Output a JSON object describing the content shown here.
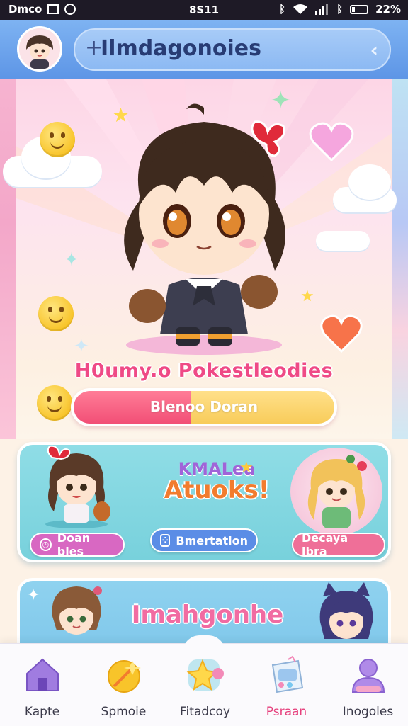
{
  "status_bar": {
    "left_text": "Dmco",
    "time": "8S11",
    "battery": "22%",
    "battery_level": 0.22
  },
  "header": {
    "search_text": "Ilmdagonoies",
    "search_icon": "plus-cursor-icon",
    "back_icon": "chevron-left-icon",
    "avatar_icon": "chibi-avatar"
  },
  "hero": {
    "title": "H0umy.o Pokestleodies",
    "progress_label": "Blenoo Doran",
    "progress_fraction": 0.45,
    "colors": {
      "fill": "#f24f76",
      "rest": "#f8cc5a",
      "title": "#ef4a86"
    }
  },
  "card1": {
    "banner_top": "KMALea",
    "banner_bottom": "Atuoks!",
    "left_pill": "Doan bles",
    "center_pill": "Bmertation",
    "right_pill": "Decaya lbra",
    "colors": {
      "left_pill": "#d868c2",
      "center_pill": "#5b8de6",
      "right_pill": "#ef6f98"
    }
  },
  "card2": {
    "title": "Imahgonhe"
  },
  "bottom_nav": {
    "items": [
      {
        "label": "Kapte",
        "icon": "home-icon"
      },
      {
        "label": "Spmoie",
        "icon": "magic-icon"
      },
      {
        "label": "Fitadcoy",
        "icon": "star-icon"
      },
      {
        "label": "Psraan",
        "icon": "gift-icon",
        "active": true
      },
      {
        "label": "Inogoles",
        "icon": "profile-icon"
      }
    ],
    "active_color": "#e63f7c"
  }
}
